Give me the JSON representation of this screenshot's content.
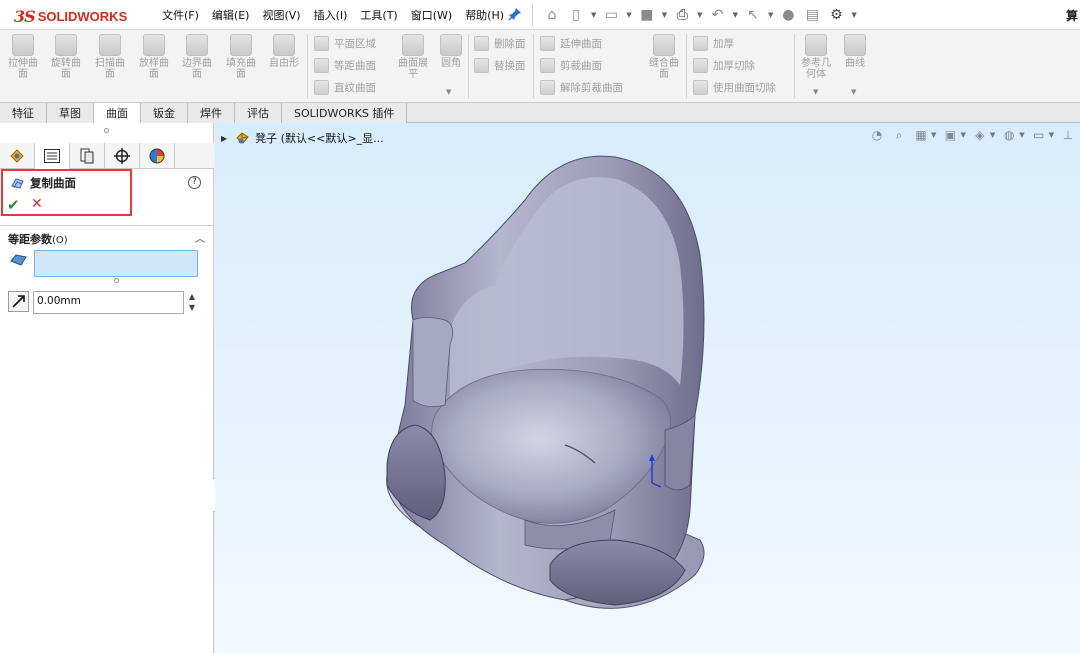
{
  "app": {
    "logo_ds": "3S",
    "logo_text": "SOLIDWORKS",
    "corner_text": "算"
  },
  "menu": [
    "文件(F)",
    "编辑(E)",
    "视图(V)",
    "插入(I)",
    "工具(T)",
    "窗口(W)",
    "帮助(H)"
  ],
  "ribbon": {
    "big_buttons": [
      "拉伸曲面",
      "旋转曲面",
      "扫描曲面",
      "放样曲面",
      "边界曲面",
      "填充曲面",
      "自由形"
    ],
    "col1": [
      "平面区域",
      "等距曲面",
      "直纹曲面"
    ],
    "flatten": "曲面展平",
    "fillet": "圆角",
    "col2": [
      "删除面",
      "替换面"
    ],
    "col3": [
      "延伸曲面",
      "剪裁曲面",
      "解除剪裁曲面"
    ],
    "knit": "缝合曲面",
    "col4": [
      "加厚",
      "加厚切除",
      "使用曲面切除"
    ],
    "ref_geometry": "参考几何体",
    "curves": "曲线"
  },
  "tabs": [
    "特征",
    "草图",
    "曲面",
    "钣金",
    "焊件",
    "评估",
    "SOLIDWORKS 插件"
  ],
  "active_tab": "曲面",
  "property_manager": {
    "title": "复制曲面",
    "help": "?",
    "ok": "✔",
    "cancel": "✕",
    "group_title": "等距参数",
    "group_hint": "(O)",
    "distance_value": "0.00mm",
    "selection_value": ""
  },
  "graphics": {
    "tree_item": "凳子  (默认<<默认>_显..."
  },
  "colors": {
    "brand": "#d52b1e",
    "highlight_box": "#e53935",
    "selection_fill": "#cfe6fb",
    "model_fill": "#9a9ab8"
  }
}
